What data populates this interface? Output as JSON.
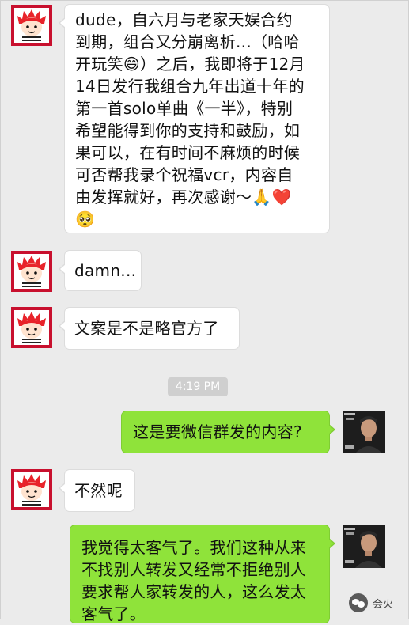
{
  "chat": {
    "messages": [
      {
        "side": "left",
        "lines": [
          "dude，自六月与老家天娱合约",
          "到期，组合又分崩离析...（哈哈",
          "开玩笑😄）之后，我即将于12月",
          "14日发行我组合九年出道十年的",
          "第一首solo单曲《一半》，特别",
          "希望能得到你的支持和鼓励，如",
          "果可以，在有时间不麻烦的时候",
          "可否帮我录个祝福vcr，内容自",
          "由发挥就好，再次感谢～🙏❤️",
          "🥺"
        ]
      },
      {
        "side": "left",
        "lines": [
          "damn..."
        ]
      },
      {
        "side": "left",
        "lines": [
          "文案是不是略官方了"
        ]
      },
      {
        "side": "right",
        "lines": [
          "这是要微信群发的内容?"
        ]
      },
      {
        "side": "left",
        "lines": [
          "不然呢"
        ]
      },
      {
        "side": "right",
        "lines": [
          "我觉得太客气了。我们这种从来",
          "不找别人转发又经常不拒绝别人",
          "要求帮人家转发的人，这么发太",
          "客气了。"
        ]
      }
    ],
    "timestamp": "4:19 PM"
  },
  "watermark": {
    "text": "会火"
  },
  "icons": {
    "left_avatar": "cartoon-boy-avatar-icon",
    "right_avatar": "man-photo-avatar-icon",
    "watermark": "wechat-logo-icon"
  },
  "colors": {
    "background": "#ebebeb",
    "bubble_left": "#ffffff",
    "bubble_right": "#8fe33a",
    "avatar_border": "#c8102e",
    "timestamp_bg": "#cfcfcf"
  }
}
